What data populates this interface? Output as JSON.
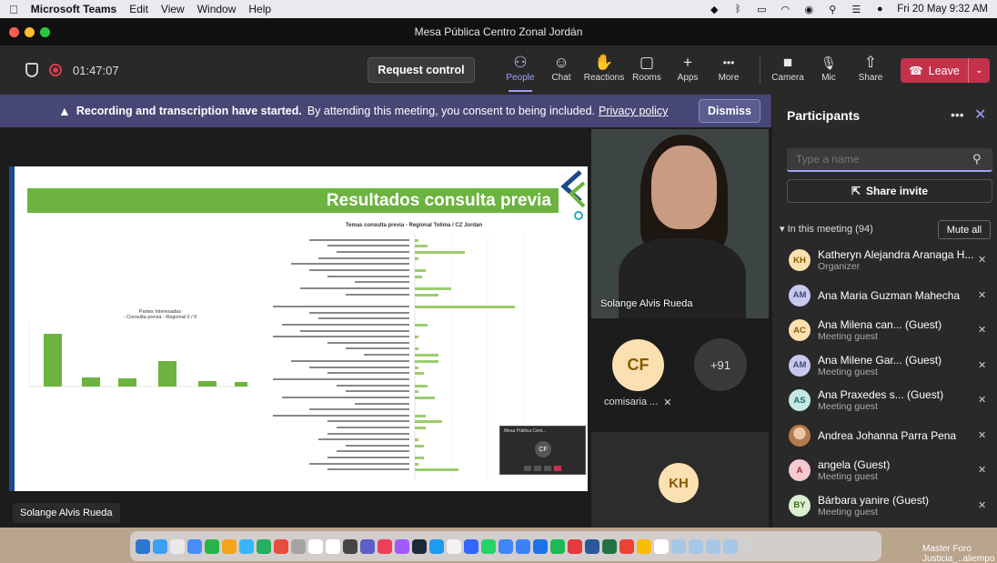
{
  "menubar": {
    "app_name": "Microsoft Teams",
    "menus": [
      "Edit",
      "View",
      "Window",
      "Help"
    ],
    "datetime": "Fri 20 May  9:32 AM"
  },
  "window": {
    "title": "Mesa Pública Centro Zonal Jordán"
  },
  "toolbar": {
    "timer": "01:47:07",
    "request_control": "Request control",
    "items": [
      {
        "label": "People",
        "icon": "people-icon",
        "glyph": "⚇"
      },
      {
        "label": "Chat",
        "icon": "chat-icon",
        "glyph": "☺"
      },
      {
        "label": "Reactions",
        "icon": "reactions-icon",
        "glyph": "✋"
      },
      {
        "label": "Rooms",
        "icon": "rooms-icon",
        "glyph": "▢"
      },
      {
        "label": "Apps",
        "icon": "apps-icon",
        "glyph": "+"
      },
      {
        "label": "More",
        "icon": "more-icon",
        "glyph": "•••"
      },
      {
        "label": "Camera",
        "icon": "camera-off-icon",
        "glyph": "■"
      },
      {
        "label": "Mic",
        "icon": "mic-off-icon",
        "glyph": "🎙"
      },
      {
        "label": "Share",
        "icon": "share-icon",
        "glyph": "⇧"
      }
    ],
    "leave": "Leave"
  },
  "banner": {
    "bold": "Recording and transcription have started.",
    "text": "By attending this meeting, you consent to being included.",
    "link": "Privacy policy",
    "dismiss": "Dismiss"
  },
  "slide": {
    "title": "Resultados consulta previa",
    "pie_title": "Partes Interesadas\n- Consulta previa - Regional 0 / 0",
    "bar_title": "Temas consulta previa - Regional Tolima / CZ Jordan"
  },
  "stage": {
    "presenter_label": "Solange Alvis Rueda",
    "video_name": "Solange Alvis Rueda",
    "cf_initials": "CF",
    "cf_name": "comisaria ...",
    "more_count": "+91",
    "kh_initials": "KH"
  },
  "mini_window": {
    "title": "Mesa Pública Cent...",
    "initials": "CF"
  },
  "panel": {
    "title": "Participants",
    "search_placeholder": "Type a name",
    "share_invite": "Share invite",
    "in_meeting": "In this meeting (94)",
    "mute_all": "Mute all",
    "participants": [
      {
        "initials": "KH",
        "name": "Katheryn Alejandra Aranaga H...",
        "role": "Organizer",
        "bg": "#fbe1b1",
        "fg": "#8a5a00"
      },
      {
        "initials": "AM",
        "name": "Ana Maria Guzman Mahecha",
        "role": "",
        "bg": "#c8c7ef",
        "fg": "#464775"
      },
      {
        "initials": "AC",
        "name": "Ana Milena can...  (Guest)",
        "role": "Meeting guest",
        "bg": "#fbe1b1",
        "fg": "#8a5a00"
      },
      {
        "initials": "AM",
        "name": "Ana Milene Gar...  (Guest)",
        "role": "Meeting guest",
        "bg": "#c8c7ef",
        "fg": "#464775"
      },
      {
        "initials": "AS",
        "name": "Ana Praxedes s...  (Guest)",
        "role": "Meeting guest",
        "bg": "#c5e8e2",
        "fg": "#1f6f63"
      },
      {
        "initials": "",
        "name": "Andrea Johanna Parra Pena",
        "role": "",
        "bg": "#e7c2a3",
        "fg": "#6b3f1f"
      },
      {
        "initials": "A",
        "name": "angela (Guest)",
        "role": "Meeting guest",
        "bg": "#f6c8cf",
        "fg": "#a4262c"
      },
      {
        "initials": "BY",
        "name": "Bárbara yanire (Guest)",
        "role": "Meeting guest",
        "bg": "#dbeed0",
        "fg": "#3b6a1e"
      }
    ]
  },
  "dock": {
    "wall_text": "Master Foro\nJusticia_..aliempo"
  },
  "colors": {
    "accent": "#9ea2ff",
    "leave": "#c4314b",
    "banner": "#464775",
    "slide_green": "#6db33f"
  }
}
